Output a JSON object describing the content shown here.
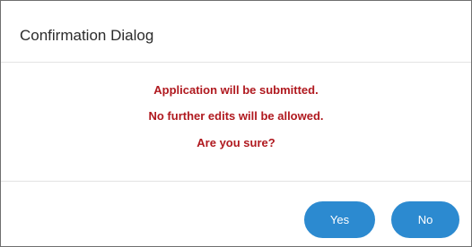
{
  "dialog": {
    "title": "Confirmation Dialog",
    "message_lines": [
      "Application will be submitted.",
      "No further edits will be allowed.",
      "Are you sure?"
    ],
    "message_color": "#b0191f",
    "buttons": {
      "yes_label": "Yes",
      "no_label": "No",
      "color": "#2c8ad0"
    }
  }
}
